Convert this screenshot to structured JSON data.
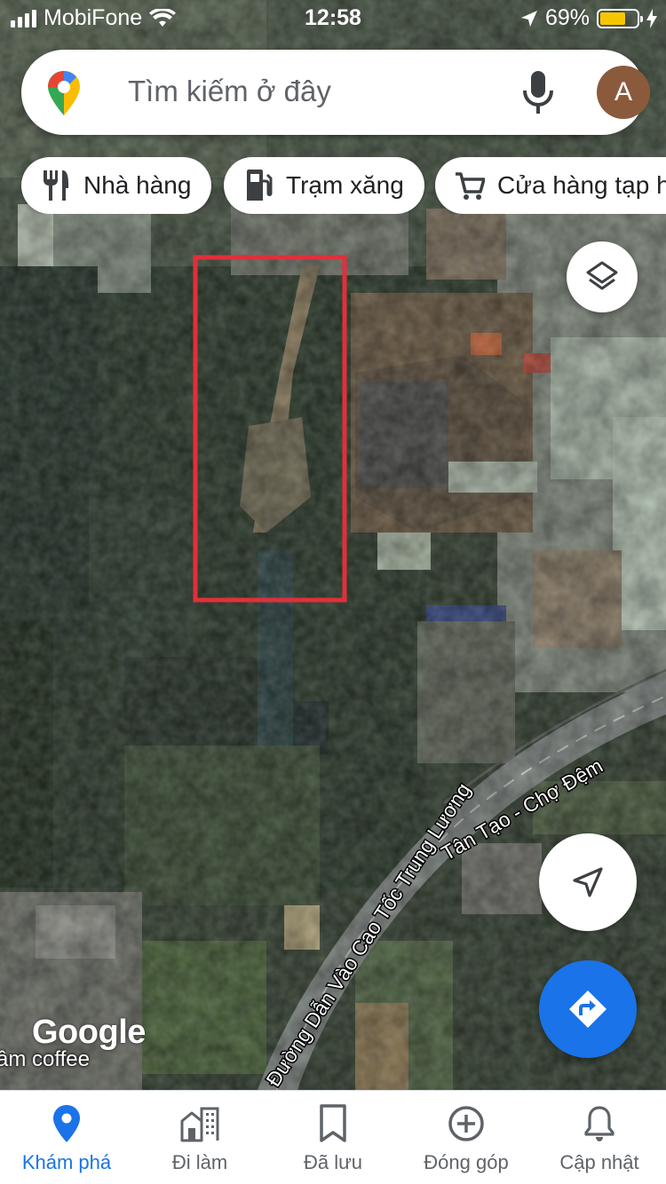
{
  "status_bar": {
    "carrier": "MobiFone",
    "time": "12:58",
    "battery": "69%",
    "battery_level": 0.69,
    "battery_color": "#f7c600"
  },
  "search": {
    "placeholder": "Tìm kiếm ở đây",
    "mic_icon": "mic-icon",
    "avatar_initial": "A",
    "avatar_color": "#8b5a3c"
  },
  "chips": [
    {
      "label": "Nhà hàng",
      "icon": "fork-knife-icon"
    },
    {
      "label": "Trạm xăng",
      "icon": "gas-station-icon"
    },
    {
      "label": "Cửa hàng tạp hóa",
      "icon": "shopping-cart-icon"
    }
  ],
  "map": {
    "roads": [
      "Đường Dẫn Vào Cao Tốc Trung Lương",
      "Tân Tạo - Chợ Đệm"
    ],
    "place_label": "âm coffee",
    "attribution": "Google",
    "highlight_color": "#e0303a"
  },
  "buttons": {
    "layers_icon": "layers-icon",
    "location_icon": "navigation-arrow-icon",
    "directions_icon": "directions-icon",
    "directions_color": "#1a73e8"
  },
  "bottom_nav": [
    {
      "label": "Khám phá",
      "icon": "location-pin-icon",
      "active": true
    },
    {
      "label": "Đi làm",
      "icon": "commute-buildings-icon",
      "active": false
    },
    {
      "label": "Đã lưu",
      "icon": "bookmark-icon",
      "active": false
    },
    {
      "label": "Đóng góp",
      "icon": "add-circle-icon",
      "active": false
    },
    {
      "label": "Cập nhật",
      "icon": "bell-icon",
      "active": false
    }
  ]
}
